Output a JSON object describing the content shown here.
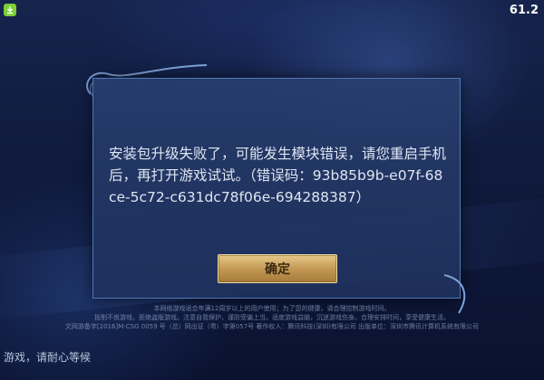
{
  "status_bar": {
    "app_icon": "notification-app-icon",
    "time": "61.2"
  },
  "dialog": {
    "message": "安装包升级失败了，可能发生模块错误，请您重启手机后，再打开游戏试试。（错误码：93b85b9b-e07f-68ce-5c72-c631dc78f06e-694288387）",
    "confirm_label": "确定"
  },
  "footer": {
    "legal_lines": [
      "本网络游戏适合年满12周岁以上的用户使用；为了您的健康，请合理控制游戏时间。",
      "抵制不良游戏，拒绝盗版游戏。注意自我保护，谨防受骗上当。适度游戏益脑，沉迷游戏伤身。合理安排时间，享受健康生活。",
      "文网游备字[2016]M-CSG 0059 号（总）网出证（粤）字第057号 著作权人：腾讯科技(深圳)有限公司 出版单位：深圳市腾讯计算机系统有限公司"
    ],
    "loading_text": "游戏，请耐心等候"
  },
  "colors": {
    "accent_gold": "#c49a55",
    "dialog_border": "#4f78b8",
    "status_icon": "#7bd034"
  }
}
